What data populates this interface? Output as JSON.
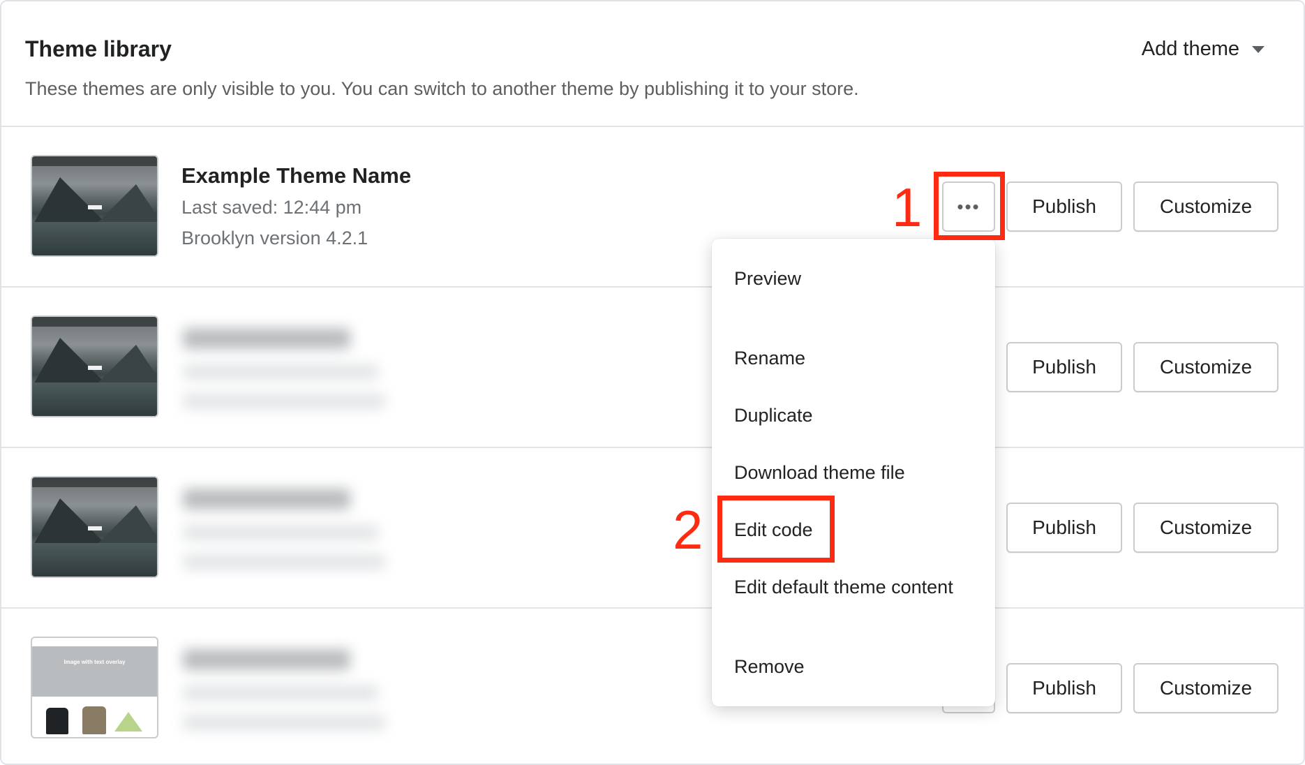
{
  "header": {
    "title": "Theme library",
    "subtitle": "These themes are only visible to you. You can switch to another theme by publishing it to your store.",
    "add_theme_label": "Add theme"
  },
  "themes": [
    {
      "name": "Example Theme Name",
      "last_saved": "Last saved: 12:44 pm",
      "version": "Brooklyn version 4.2.1",
      "publish_label": "Publish",
      "customize_label": "Customize",
      "more_label": "•••"
    },
    {
      "publish_label": "Publish",
      "customize_label": "Customize"
    },
    {
      "publish_label": "Publish",
      "customize_label": "Customize"
    },
    {
      "thumb_text": "Image with text overlay",
      "publish_label": "Publish",
      "customize_label": "Customize"
    }
  ],
  "menu": {
    "items": [
      "Preview",
      "Rename",
      "Duplicate",
      "Download theme file",
      "Edit code",
      "Edit default theme content",
      "Remove"
    ]
  },
  "annotations": {
    "step1": "1",
    "step2": "2"
  },
  "colors": {
    "highlight": "#ff2a12"
  }
}
